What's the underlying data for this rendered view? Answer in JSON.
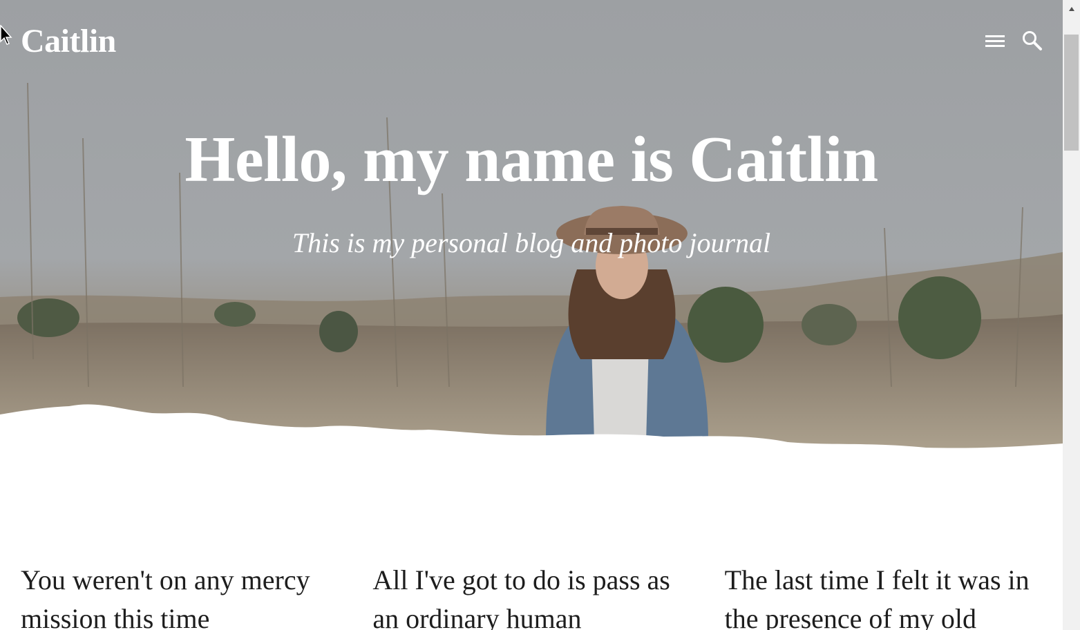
{
  "header": {
    "site_title": "Caitlin",
    "menu_icon": "hamburger-menu-icon",
    "search_icon": "search-icon"
  },
  "hero": {
    "heading": "Hello, my name is Caitlin",
    "tagline": "This is my personal blog and photo journal",
    "image_desc": "woman-in-hat-in-field",
    "colors": {
      "sky": "#9ea1a5",
      "field": "#7d6f5e",
      "accent_white": "#ffffff"
    }
  },
  "posts": [
    {
      "title": "You weren't on any mercy mission this time"
    },
    {
      "title": "All I've got to do is pass as an ordinary human"
    },
    {
      "title": "The last time I felt it was in the presence of my old"
    }
  ],
  "scrollbar": {
    "up_icon": "scroll-up-arrow-icon"
  }
}
